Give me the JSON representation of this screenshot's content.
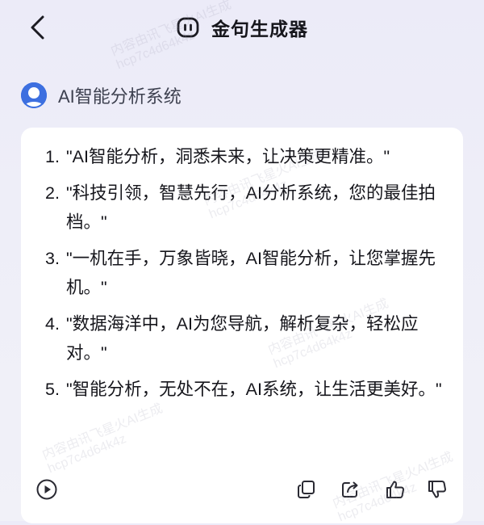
{
  "header": {
    "title": "金句生成器"
  },
  "agent": {
    "name": "AI智能分析系统"
  },
  "response": {
    "items": [
      {
        "num": "1.",
        "text": "\"AI智能分析，洞悉未来，让决策更精准。\""
      },
      {
        "num": "2.",
        "text": "\"科技引领，智慧先行，AI分析系统，您的最佳拍档。\""
      },
      {
        "num": "3.",
        "text": "\"一机在手，万象皆晓，AI智能分析，让您掌握先机。\""
      },
      {
        "num": "4.",
        "text": "\"数据海洋中，AI为您导航，解析复杂，轻松应对。\""
      },
      {
        "num": "5.",
        "text": "\"智能分析，无处不在，AI系统，让生活更美好。\""
      }
    ]
  },
  "watermark": {
    "line1": "内容由讯飞星火AI生成",
    "line2": "hcp7c4d64k4z"
  },
  "colors": {
    "avatar": "#3d6fe0",
    "text": "#16161c",
    "icon": "#2a2a33"
  }
}
